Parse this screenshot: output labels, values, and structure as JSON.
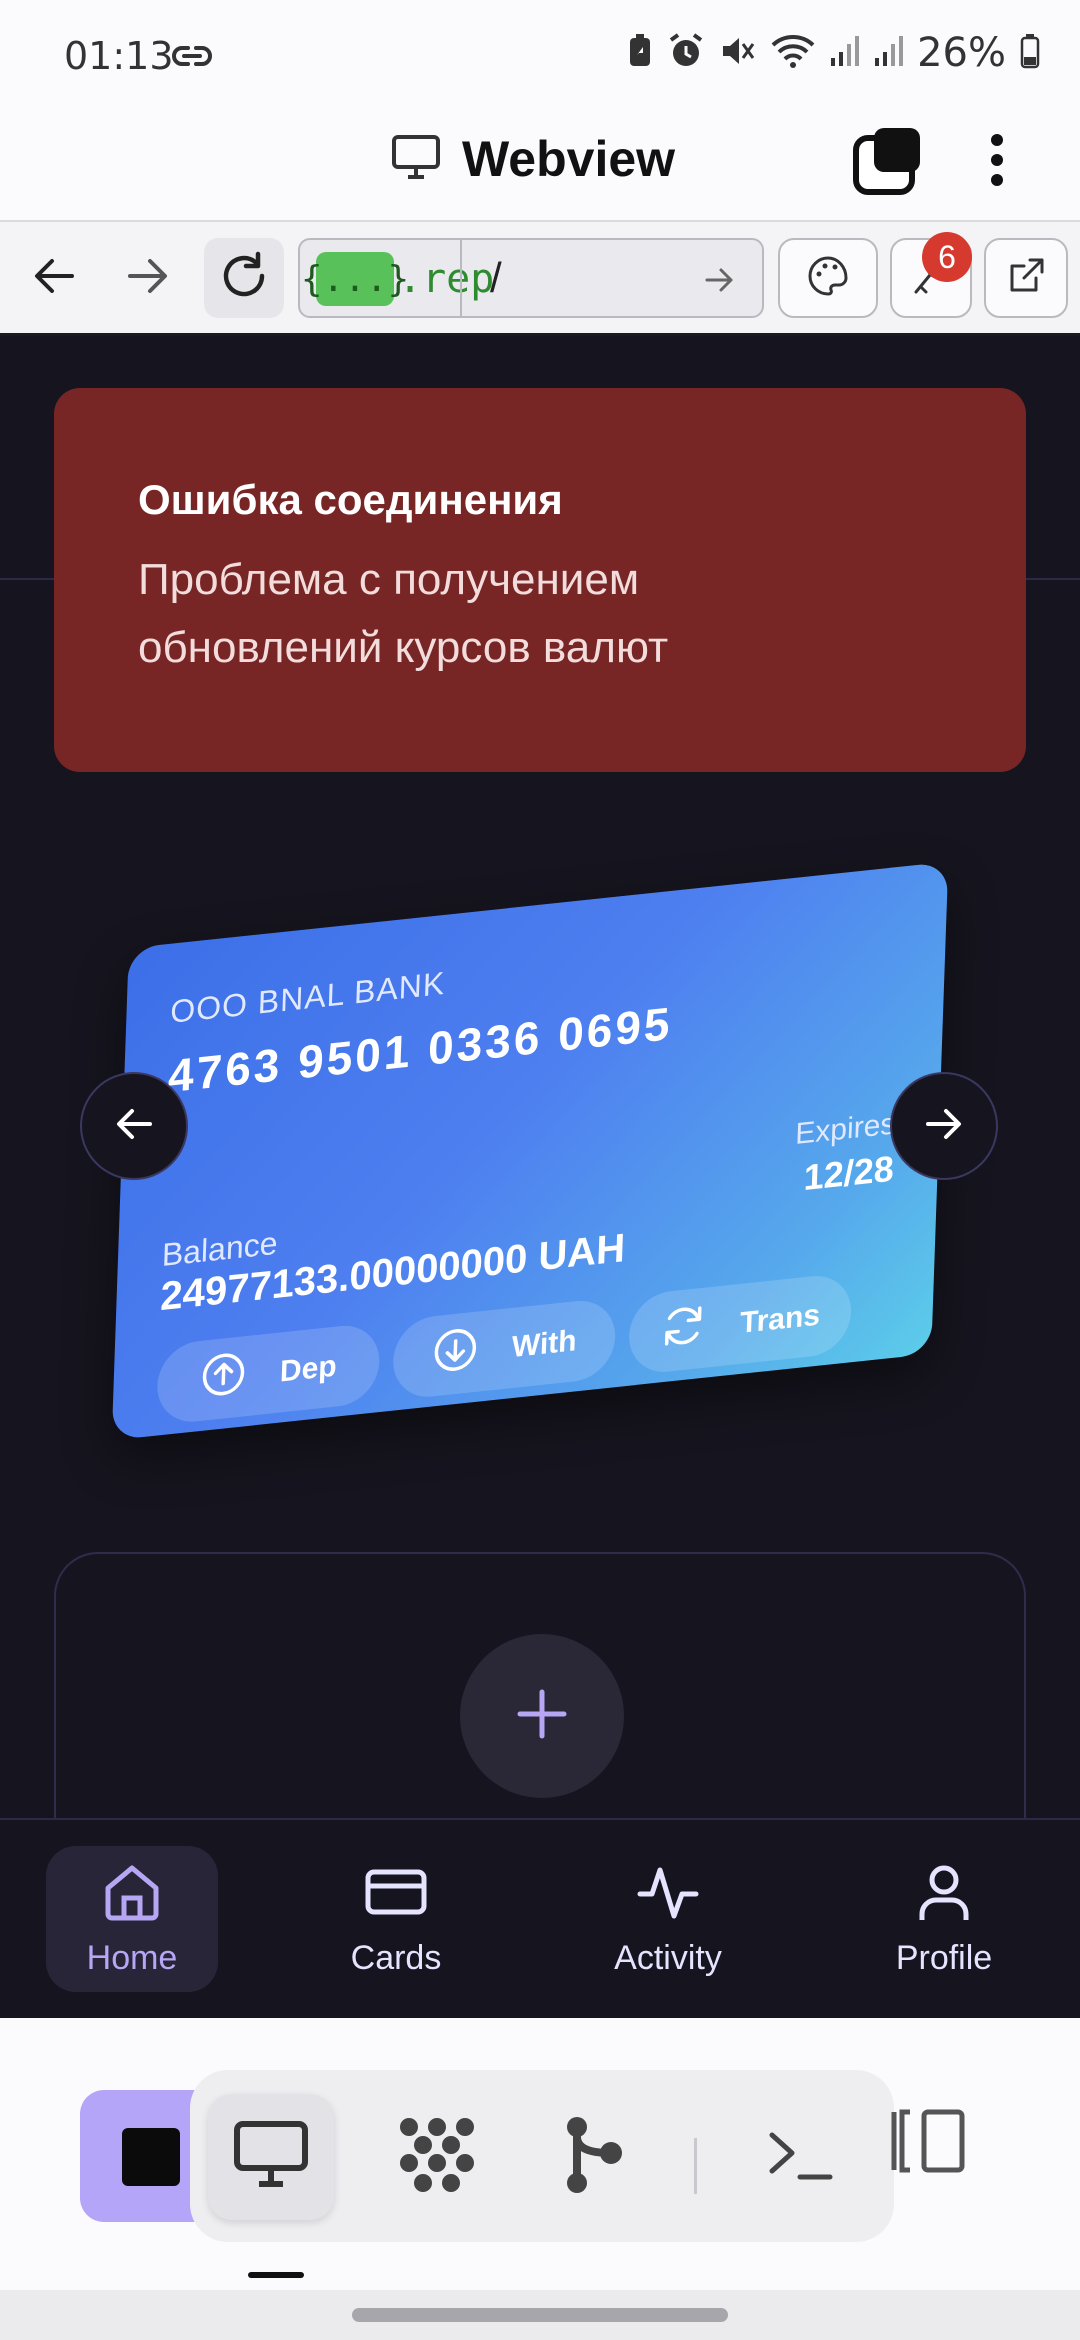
{
  "status_bar": {
    "time": "01:13",
    "battery": "26%",
    "icons": [
      "link-icon",
      "battery-saver-icon",
      "alarm-icon",
      "mute-icon",
      "wifi-icon",
      "signal-icon",
      "signal-icon",
      "battery-icon"
    ]
  },
  "app_bar": {
    "title": "Webview",
    "icons": [
      "monitor-icon",
      "tabs-icon",
      "more-vert-icon"
    ]
  },
  "browser_toolbar": {
    "url_badge": "{...}",
    "url_domain": ".rep",
    "url_path": "/",
    "key_badge_count": "6",
    "icons": [
      "back-arrow-icon",
      "forward-arrow-icon",
      "reload-icon",
      "go-arrow-icon",
      "palette-icon",
      "key-icon",
      "open-external-icon"
    ]
  },
  "error": {
    "title": "Ошибка соединения",
    "message": "Проблема с получением обновлений курсов валют"
  },
  "card": {
    "bank_name": "OOO BNAL BANK",
    "number": "4763 9501 0336 0695",
    "balance_label": "Balance",
    "balance_value": "24977133.00000000 UAH",
    "expires_label": "Expires",
    "expires_value": "12/28",
    "actions": [
      {
        "label": "Dep",
        "icon": "arrow-up-circle-icon"
      },
      {
        "label": "With",
        "icon": "arrow-down-circle-icon"
      },
      {
        "label": "Trans",
        "icon": "refresh-icon"
      }
    ],
    "gradient": [
      "#3c6fe8",
      "#5ccde9"
    ]
  },
  "bottom_nav": [
    {
      "label": "Home",
      "icon": "home-icon",
      "active": true
    },
    {
      "label": "Cards",
      "icon": "credit-card-icon",
      "active": false
    },
    {
      "label": "Activity",
      "icon": "activity-icon",
      "active": false
    },
    {
      "label": "Profile",
      "icon": "user-icon",
      "active": false
    }
  ],
  "dock": {
    "icons": [
      "stop-square-icon",
      "monitor-icon",
      "packages-icon",
      "git-branch-icon",
      "terminal-icon",
      "layout-icon"
    ]
  },
  "colors": {
    "page_bg": "#16151f",
    "error_bg": "#772625",
    "accent": "#b7a6f4",
    "dock_accent": "#b4a5f8"
  }
}
